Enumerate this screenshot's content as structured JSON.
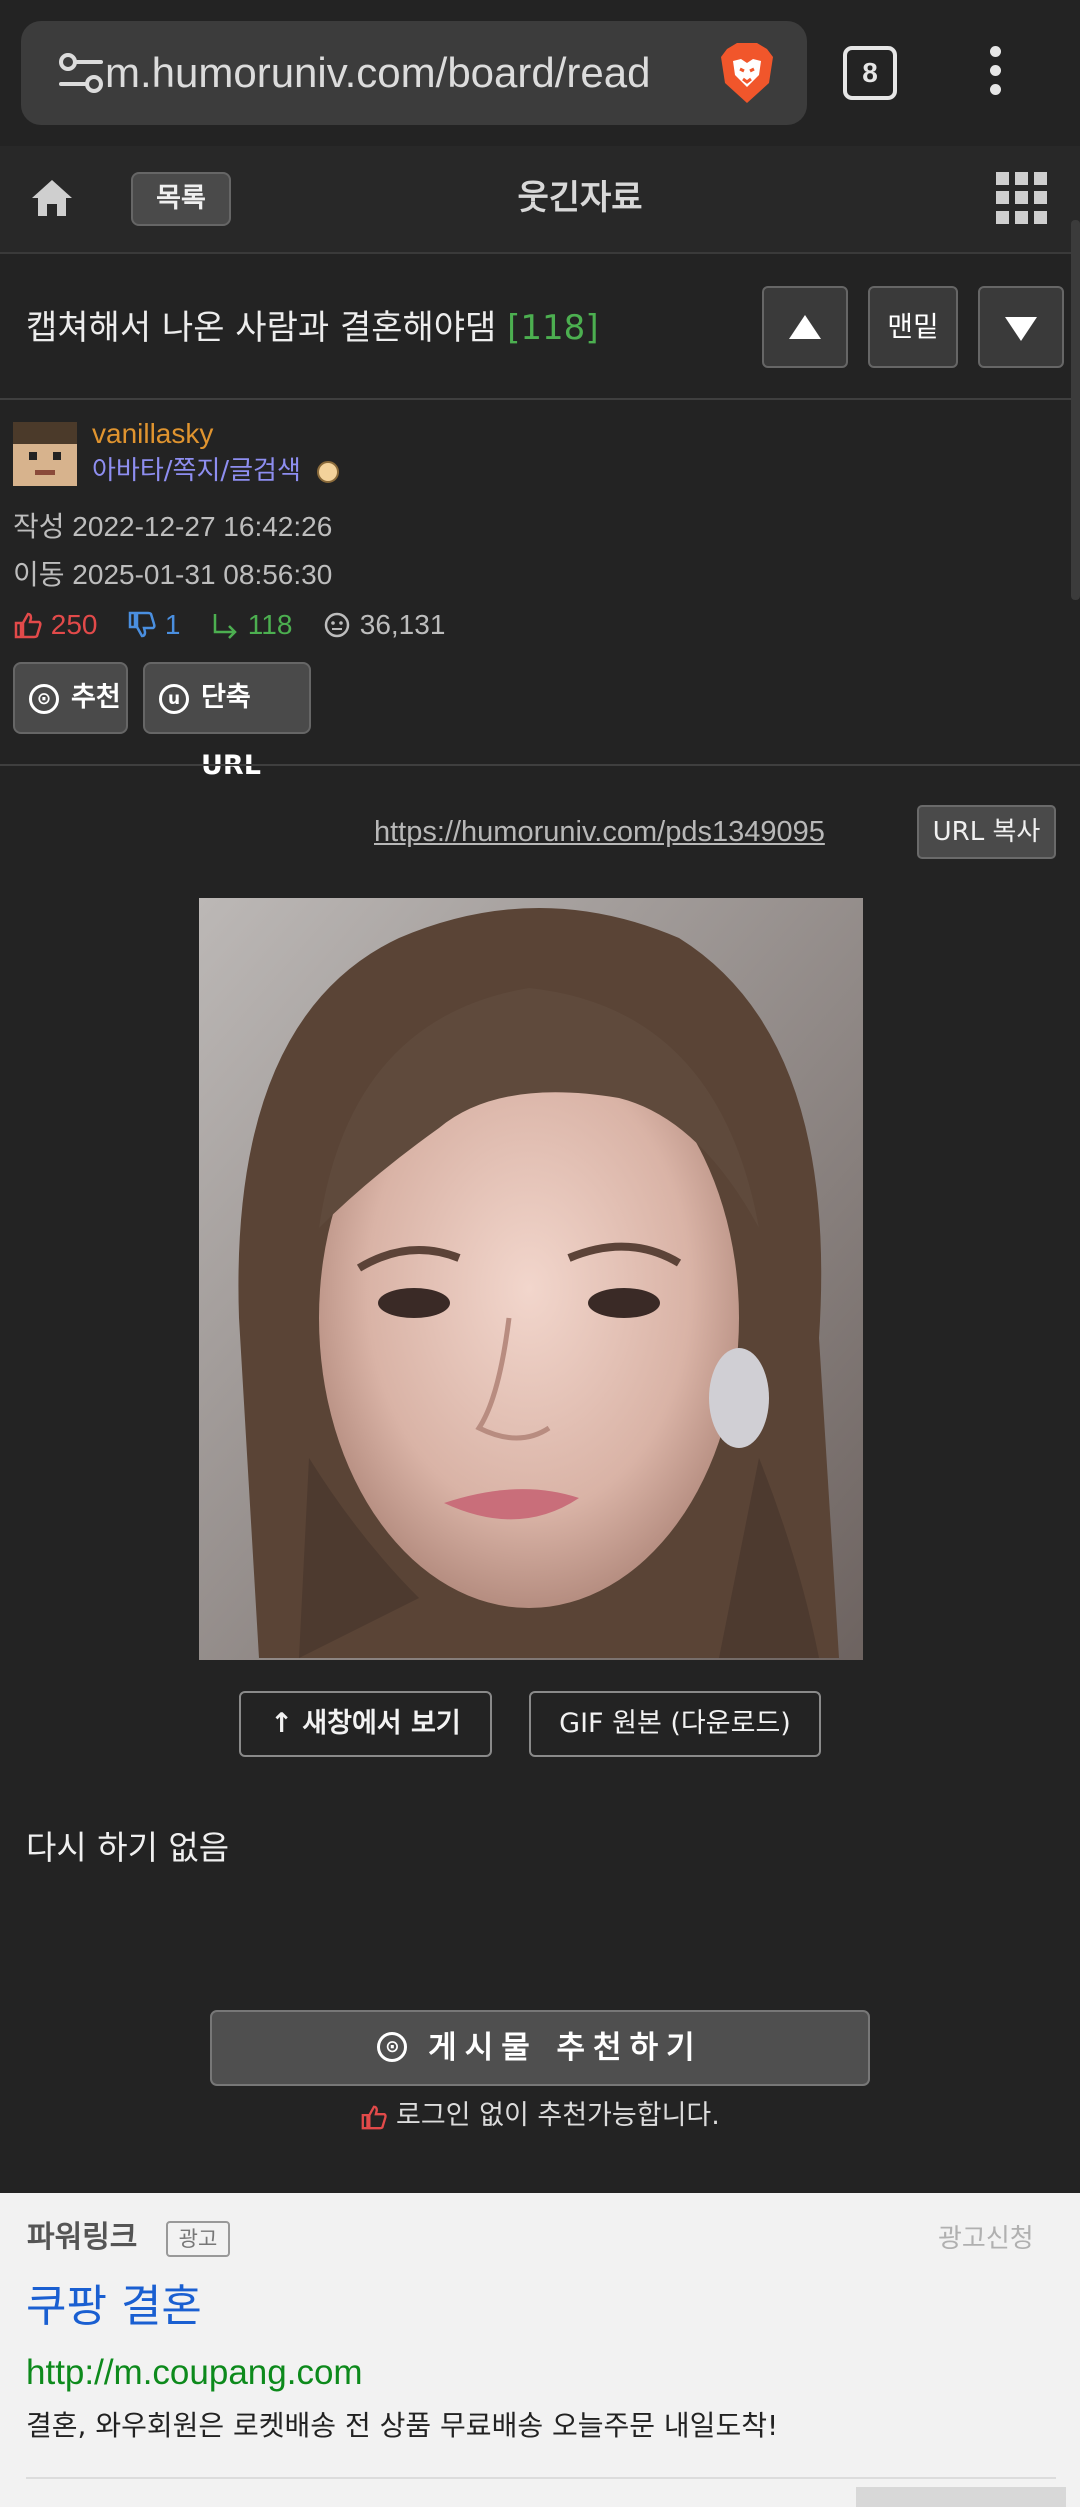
{
  "browser": {
    "url": "m.humoruniv.com/board/read",
    "tab_count": "8"
  },
  "header": {
    "list_label": "목록",
    "board_title": "웃긴자료"
  },
  "post": {
    "title": "캡쳐해서 나온 사람과 결혼해야댐",
    "comment_count": "[118]",
    "nav": {
      "bottom_label": "맨밑"
    },
    "author": {
      "name": "vanillasky",
      "links": "아바타/쪽지/글검색"
    },
    "written": "작성 2022-12-27 16:42:26",
    "moved": "이동 2025-01-31 08:56:30",
    "stats": {
      "likes": "250",
      "dislikes": "1",
      "replies": "118",
      "views": "36,131"
    },
    "recommend_label": "추천",
    "shorturl_label": "단축URL",
    "short_url": "https://humoruniv.com/pds1349095",
    "url_copy_label": "URL 복사",
    "new_window_label": "↑ 새창에서 보기",
    "gif_label": "GIF 원본 (다운로드)",
    "body_text": "다시 하기 없음",
    "recommend_big_label": "게시물 추천하기",
    "recommend_note": "로그인 없이 추천가능합니다."
  },
  "ad": {
    "brand": "파워링크",
    "tag": "광고",
    "request": "광고신청",
    "title": "쿠팡 결혼",
    "link": "http://m.coupang.com",
    "description": "결혼, 와우회원은 로켓배송 전 상품 무료배송 오늘주문 내일도착!"
  },
  "colors": {
    "background": "#232323",
    "comment_count": "#4caf50",
    "username": "#e0942f",
    "user_links": "#8e8ef0",
    "likes": "#e24a4a",
    "dislikes": "#4a8fe0",
    "replies": "#4caf50",
    "ad_title": "#1a5fd1",
    "ad_link": "#0d8a1c"
  }
}
